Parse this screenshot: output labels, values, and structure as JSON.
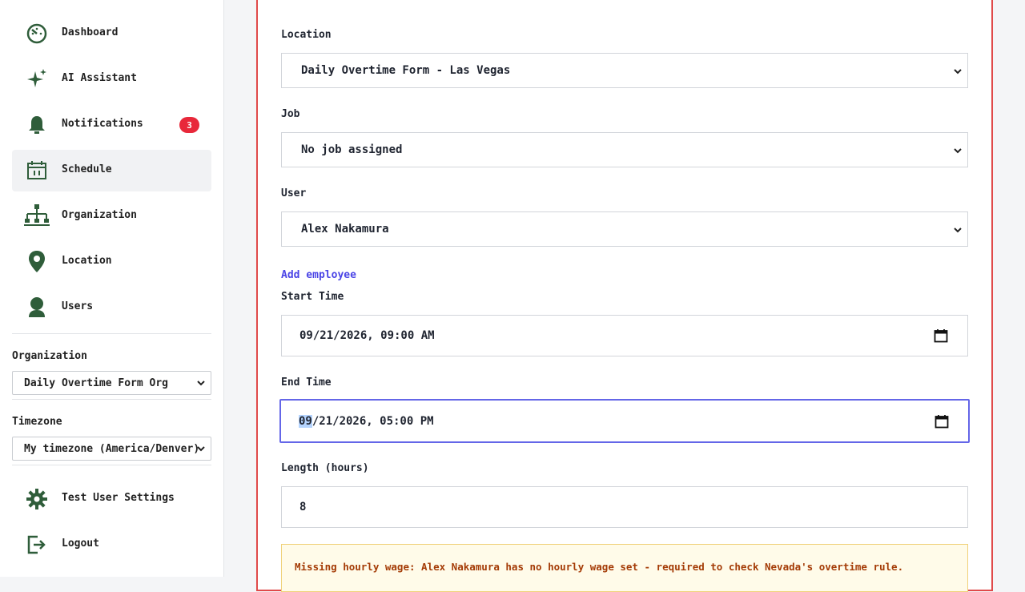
{
  "sidebar": {
    "items": [
      {
        "label": "Dashboard",
        "icon": "dashboard-icon"
      },
      {
        "label": "AI Assistant",
        "icon": "sparkle-icon"
      },
      {
        "label": "Notifications",
        "icon": "bell-icon",
        "badge": "3"
      },
      {
        "label": "Schedule",
        "icon": "calendar-icon",
        "active": true
      },
      {
        "label": "Organization",
        "icon": "org-chart-icon"
      },
      {
        "label": "Location",
        "icon": "map-pin-icon"
      },
      {
        "label": "Users",
        "icon": "user-icon"
      }
    ],
    "organization": {
      "label": "Organization",
      "value": "Daily Overtime Form Org"
    },
    "timezone": {
      "label": "Timezone",
      "value": "My timezone (America/Denver)"
    },
    "settings_label": "Test User Settings",
    "logout_label": "Logout"
  },
  "form": {
    "location": {
      "label": "Location",
      "value": "Daily Overtime Form - Las Vegas"
    },
    "job": {
      "label": "Job",
      "value": "No job assigned"
    },
    "user": {
      "label": "User",
      "value": "Alex Nakamura"
    },
    "add_employee": "Add employee",
    "start_time": {
      "label": "Start Time",
      "value": "09/21/2026, 09:00 AM"
    },
    "end_time": {
      "label": "End Time",
      "value_selected": "09",
      "value_rest": "/21/2026, 05:00 PM"
    },
    "length": {
      "label": "Length (hours)",
      "value": "8"
    },
    "warning": "Missing hourly wage: Alex Nakamura has no hourly wage set - required to check Nevada's overtime rule."
  },
  "colors": {
    "accent": "#2f5d3a",
    "badge": "#e8283a",
    "focus": "#6466e8",
    "panel_border": "#e04a4a",
    "warning_text": "#a43b06"
  }
}
